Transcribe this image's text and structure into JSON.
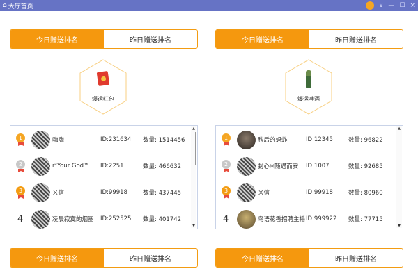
{
  "window": {
    "title": "大厅首页",
    "icons": [
      "home-icon",
      "avatar-face-icon",
      "chevron-down-icon",
      "minimize-icon",
      "maximize-icon",
      "close-icon"
    ]
  },
  "tabs": {
    "today": "今日赠送排名",
    "yesterday": "昨日赠送排名"
  },
  "sections": [
    {
      "gift": {
        "label": "爆运红包",
        "icon": "red-envelope-icon"
      },
      "ranking": [
        {
          "rank": "1",
          "name": "嗨嗨",
          "id": "ID:231634",
          "count_label": "数量:",
          "count": "1514456"
        },
        {
          "rank": "2",
          "name": "r᠎ᵛYour God™",
          "id": "ID:2251",
          "count_label": "数量:",
          "count": "466632"
        },
        {
          "rank": "3",
          "name": "ㄨ信",
          "id": "ID:99918",
          "count_label": "数量:",
          "count": "437445"
        },
        {
          "rank": "4",
          "name": "凌晨寂寞的烟圈",
          "id": "ID:252525",
          "count_label": "数量:",
          "count": "401742"
        }
      ]
    },
    {
      "gift": {
        "label": "爆运啤酒",
        "icon": "beer-bottle-icon"
      },
      "ranking": [
        {
          "rank": "1",
          "name": "秋后的蚂蚱",
          "id": "ID:12345",
          "count_label": "数量:",
          "count": "96822"
        },
        {
          "rank": "2",
          "name": "封心※随遇而安",
          "id": "ID:1007",
          "count_label": "数量:",
          "count": "92685"
        },
        {
          "rank": "3",
          "name": "ㄨ信",
          "id": "ID:99918",
          "count_label": "数量:",
          "count": "80960"
        },
        {
          "rank": "4",
          "name": "鸟语花香招聘主播",
          "id": "ID:999922",
          "count_label": "数量:",
          "count": "77715"
        }
      ]
    }
  ],
  "colors": {
    "titlebar": "#6673c5",
    "accent": "#f5980e",
    "gold": "#f5a623",
    "silver": "#c8c8c8"
  }
}
